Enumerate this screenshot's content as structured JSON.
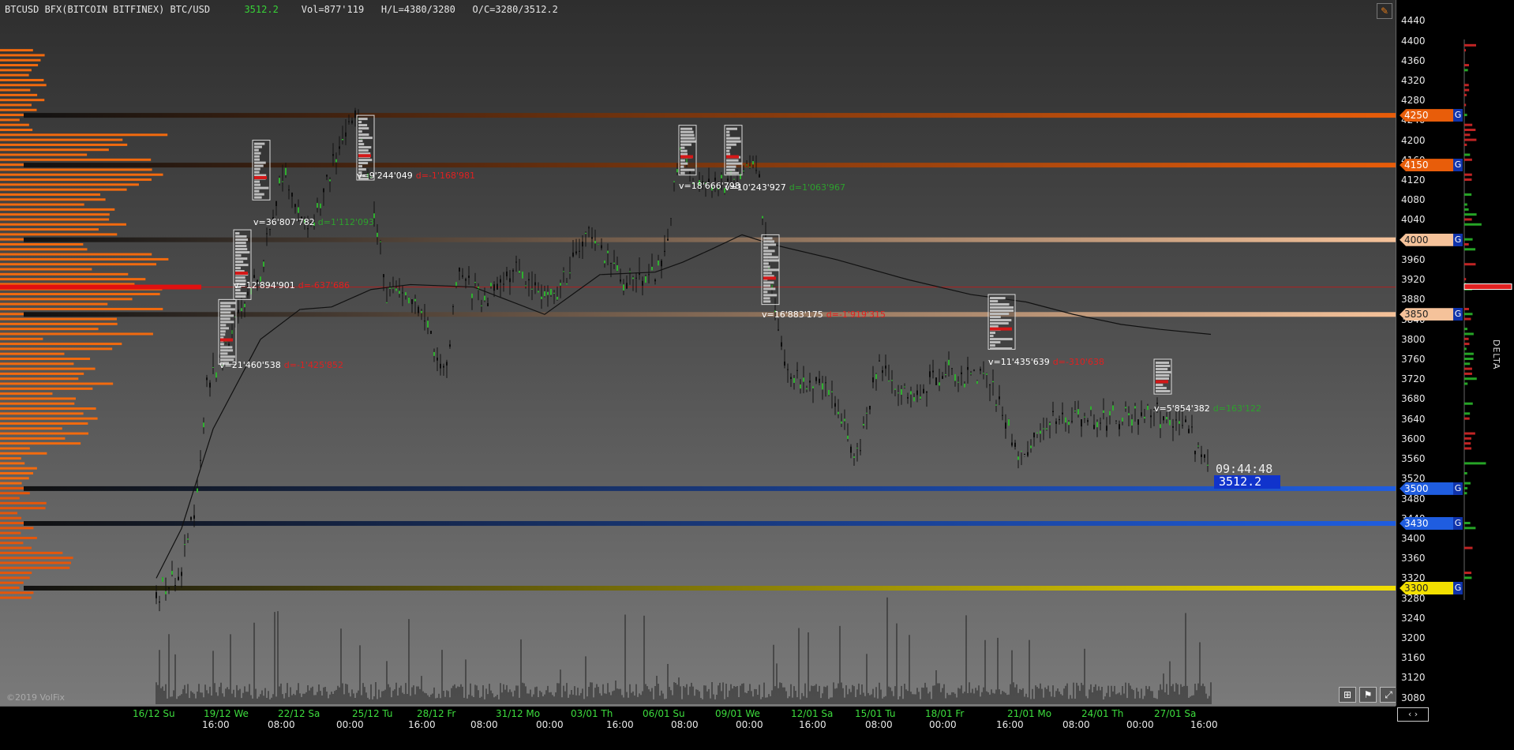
{
  "header": {
    "symbol": "BTCUSD BFX(BITCOIN BITFINEX) BTC/USD",
    "last_price": "3512.2",
    "volume": "Vol=877'119",
    "high_low": "H/L=4380/3280",
    "open_close": "O/C=3280/3512.2"
  },
  "copyright": "©2019 VolFix",
  "clock": "09:44:48",
  "current_price": "3512.2",
  "delta_label": "DELTA",
  "y_axis": {
    "ticks": [
      "4440",
      "4400",
      "4360",
      "4320",
      "4280",
      "4240",
      "4200",
      "4160",
      "4120",
      "4080",
      "4040",
      "4000",
      "3960",
      "3920",
      "3880",
      "3840",
      "3800",
      "3760",
      "3720",
      "3680",
      "3640",
      "3600",
      "3560",
      "3520",
      "3480",
      "3440",
      "3400",
      "3360",
      "3320",
      "3280",
      "3240",
      "3200",
      "3160",
      "3120",
      "3080"
    ],
    "range": [
      3070,
      4450
    ]
  },
  "levels": [
    {
      "label": "4250",
      "value": 4250,
      "color": "#e85d0a"
    },
    {
      "label": "4150",
      "value": 4150,
      "color": "#e85d0a"
    },
    {
      "label": "4000",
      "value": 4000,
      "color": "#f5c29a"
    },
    {
      "label": "3850",
      "value": 3850,
      "color": "#f5c29a"
    },
    {
      "label": "3500",
      "value": 3500,
      "color": "#1f5de0"
    },
    {
      "label": "3430",
      "value": 3430,
      "color": "#1f5de0"
    },
    {
      "label": "3300",
      "value": 3300,
      "color": "#f3e000"
    }
  ],
  "x_axis": {
    "dates": [
      "16/12 Su",
      "19/12 We",
      "22/12 Sa",
      "25/12 Tu",
      "28/12 Fr",
      "31/12 Mo",
      "03/01 Th",
      "06/01 Su",
      "09/01 We",
      "12/01 Sa",
      "15/01 Tu",
      "18/01 Fr",
      "21/01 Mo",
      "24/01 Th",
      "27/01 Sa"
    ],
    "times": [
      "16:00",
      "08:00",
      "00:00",
      "16:00",
      "08:00",
      "00:00",
      "16:00",
      "08:00",
      "00:00",
      "16:00",
      "08:00",
      "00:00",
      "16:00",
      "08:00",
      "00:00",
      "16:00"
    ]
  },
  "annotations": [
    {
      "volume": "v=21'460'538",
      "delta": "d=-1'425'852",
      "sign": "neg"
    },
    {
      "volume": "v=12'894'901",
      "delta": "d=-637'686",
      "sign": "neg"
    },
    {
      "volume": "v=36'807'782",
      "delta": "d=1'112'093",
      "sign": "pos"
    },
    {
      "volume": "v=9'244'049",
      "delta": "d=-1'168'981",
      "sign": "neg"
    },
    {
      "volume": "v=18'666'798",
      "delta": "",
      "sign": "pos"
    },
    {
      "volume": "v=10'243'927",
      "delta": "d=1'063'967",
      "sign": "pos"
    },
    {
      "volume": "v=16'883'175",
      "delta": "d=-1'919'315",
      "sign": "neg"
    },
    {
      "volume": "v=11'435'639",
      "delta": "d=-310'638",
      "sign": "neg"
    },
    {
      "volume": "v=5'854'382",
      "delta": "d=163'122",
      "sign": "pos"
    }
  ],
  "toolbar": {
    "edit_icon": "pencil-icon",
    "grid_icon": "grid-icon",
    "flag_icon": "flag-icon",
    "expand_icon": "expand-icon",
    "nav": "arrows-icon"
  }
}
